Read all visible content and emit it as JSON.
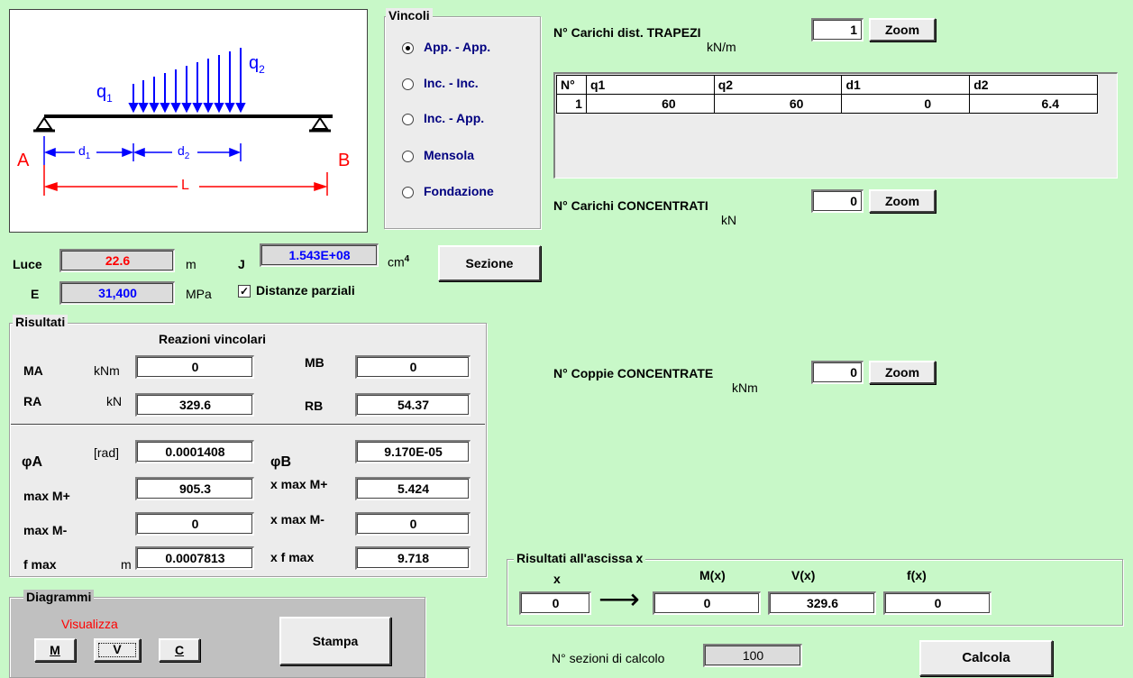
{
  "diagram": {
    "q1": "q",
    "q1_sub": "1",
    "q2": "q",
    "q2_sub": "2",
    "A": "A",
    "B": "B",
    "d1": "d",
    "d1_sub": "1",
    "d2": "d",
    "d2_sub": "2",
    "L": "L"
  },
  "vincoli": {
    "title": "Vincoli",
    "options": [
      {
        "label": "App. - App.",
        "checked": true
      },
      {
        "label": "Inc. - Inc.",
        "checked": false
      },
      {
        "label": "Inc. - App.",
        "checked": false
      },
      {
        "label": "Mensola",
        "checked": false
      },
      {
        "label": "Fondazione",
        "checked": false
      }
    ]
  },
  "inputs": {
    "luce_label": "Luce",
    "luce_value": "22.6",
    "luce_unit": "m",
    "j_label": "J",
    "j_value": "1.543E+08",
    "j_unit": "cm",
    "j_exp": "4",
    "e_label": "E",
    "e_value": "31,400",
    "e_unit": "MPa",
    "sezione_label": "Sezione",
    "distanze_label": "Distanze parziali",
    "distanze_checked": true
  },
  "trapezi": {
    "label": "N° Carichi dist. TRAPEZI",
    "unit": "kN/m",
    "count": "1",
    "zoom": "Zoom",
    "headers": [
      "N°",
      "q1",
      "q2",
      "d1",
      "d2"
    ],
    "rows": [
      [
        "1",
        "60",
        "60",
        "0",
        "6.4"
      ]
    ]
  },
  "concentrati": {
    "label": "N° Carichi CONCENTRATI",
    "unit": "kN",
    "count": "0",
    "zoom": "Zoom"
  },
  "coppie": {
    "label": "N° Coppie CONCENTRATE",
    "unit": "kNm",
    "count": "0",
    "zoom": "Zoom"
  },
  "risultati": {
    "title": "Risultati",
    "reazioni_title": "Reazioni vincolari",
    "MA_label": "MA",
    "MA_unit": "kNm",
    "MA_value": "0",
    "MB_label": "MB",
    "MB_value": "0",
    "RA_label": "RA",
    "RA_unit": "kN",
    "RA_value": "329.6",
    "RB_label": "RB",
    "RB_value": "54.37",
    "phiA_label": "φA",
    "phiA_unit": "[rad]",
    "phiA_value": "0.0001408",
    "phiB_label": "φB",
    "phiB_value": "9.170E-05",
    "maxMp_label": "max M+",
    "maxMp_value": "905.3",
    "xmaxMp_label": "x max M+",
    "xmaxMp_value": "5.424",
    "maxMm_label": "max M-",
    "maxMm_value": "0",
    "xmaxMm_label": "x max M-",
    "xmaxMm_value": "0",
    "fmax_label": "f max",
    "fmax_unit": "m",
    "fmax_value": "0.0007813",
    "xfmax_label": "x f max",
    "xfmax_value": "9.718"
  },
  "ascissa": {
    "title": "Risultati all'ascissa x",
    "x_label": "x",
    "Mx_label": "M(x)",
    "Vx_label": "V(x)",
    "fx_label": "f(x)",
    "x_value": "0",
    "Mx_value": "0",
    "Vx_value": "329.6",
    "fx_value": "0"
  },
  "diagrammi": {
    "title": "Diagrammi",
    "visualizza": "Visualizza",
    "M": "M",
    "V": "V",
    "C": "C",
    "stampa": "Stampa"
  },
  "footer": {
    "sezioni_label": "N° sezioni di calcolo",
    "sezioni_value": "100",
    "calcola": "Calcola"
  },
  "colors": {
    "background": "#c8f8c8",
    "red": "#ff0000",
    "blue": "#0000ff",
    "navy": "#000080"
  }
}
